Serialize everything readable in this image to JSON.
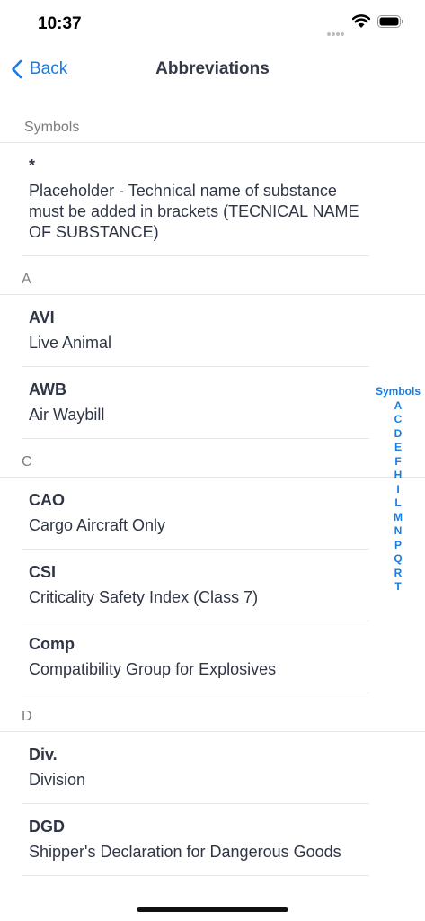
{
  "status": {
    "time": "10:37"
  },
  "nav": {
    "back_label": "Back",
    "title": "Abbreviations"
  },
  "sections": [
    {
      "header": "Symbols",
      "rows": [
        {
          "abbr": "*",
          "def": "Placeholder - Technical name of substance must be added in brackets (TECNICAL NAME OF SUBSTANCE)"
        }
      ]
    },
    {
      "header": "A",
      "rows": [
        {
          "abbr": "AVI",
          "def": "Live Animal"
        },
        {
          "abbr": "AWB",
          "def": "Air Waybill"
        }
      ]
    },
    {
      "header": "C",
      "rows": [
        {
          "abbr": "CAO",
          "def": "Cargo Aircraft Only"
        },
        {
          "abbr": "CSI",
          "def": "Criticality Safety Index (Class 7)"
        },
        {
          "abbr": "Comp",
          "def": "Compatibility Group for Explosives"
        }
      ]
    },
    {
      "header": "D",
      "rows": [
        {
          "abbr": "Div.",
          "def": "Division"
        },
        {
          "abbr": "DGD",
          "def": "Shipper's Declaration for Dangerous Goods"
        }
      ]
    }
  ],
  "index": [
    "Symbols",
    "A",
    "C",
    "D",
    "E",
    "F",
    "H",
    "I",
    "L",
    "M",
    "N",
    "P",
    "Q",
    "R",
    "T"
  ]
}
